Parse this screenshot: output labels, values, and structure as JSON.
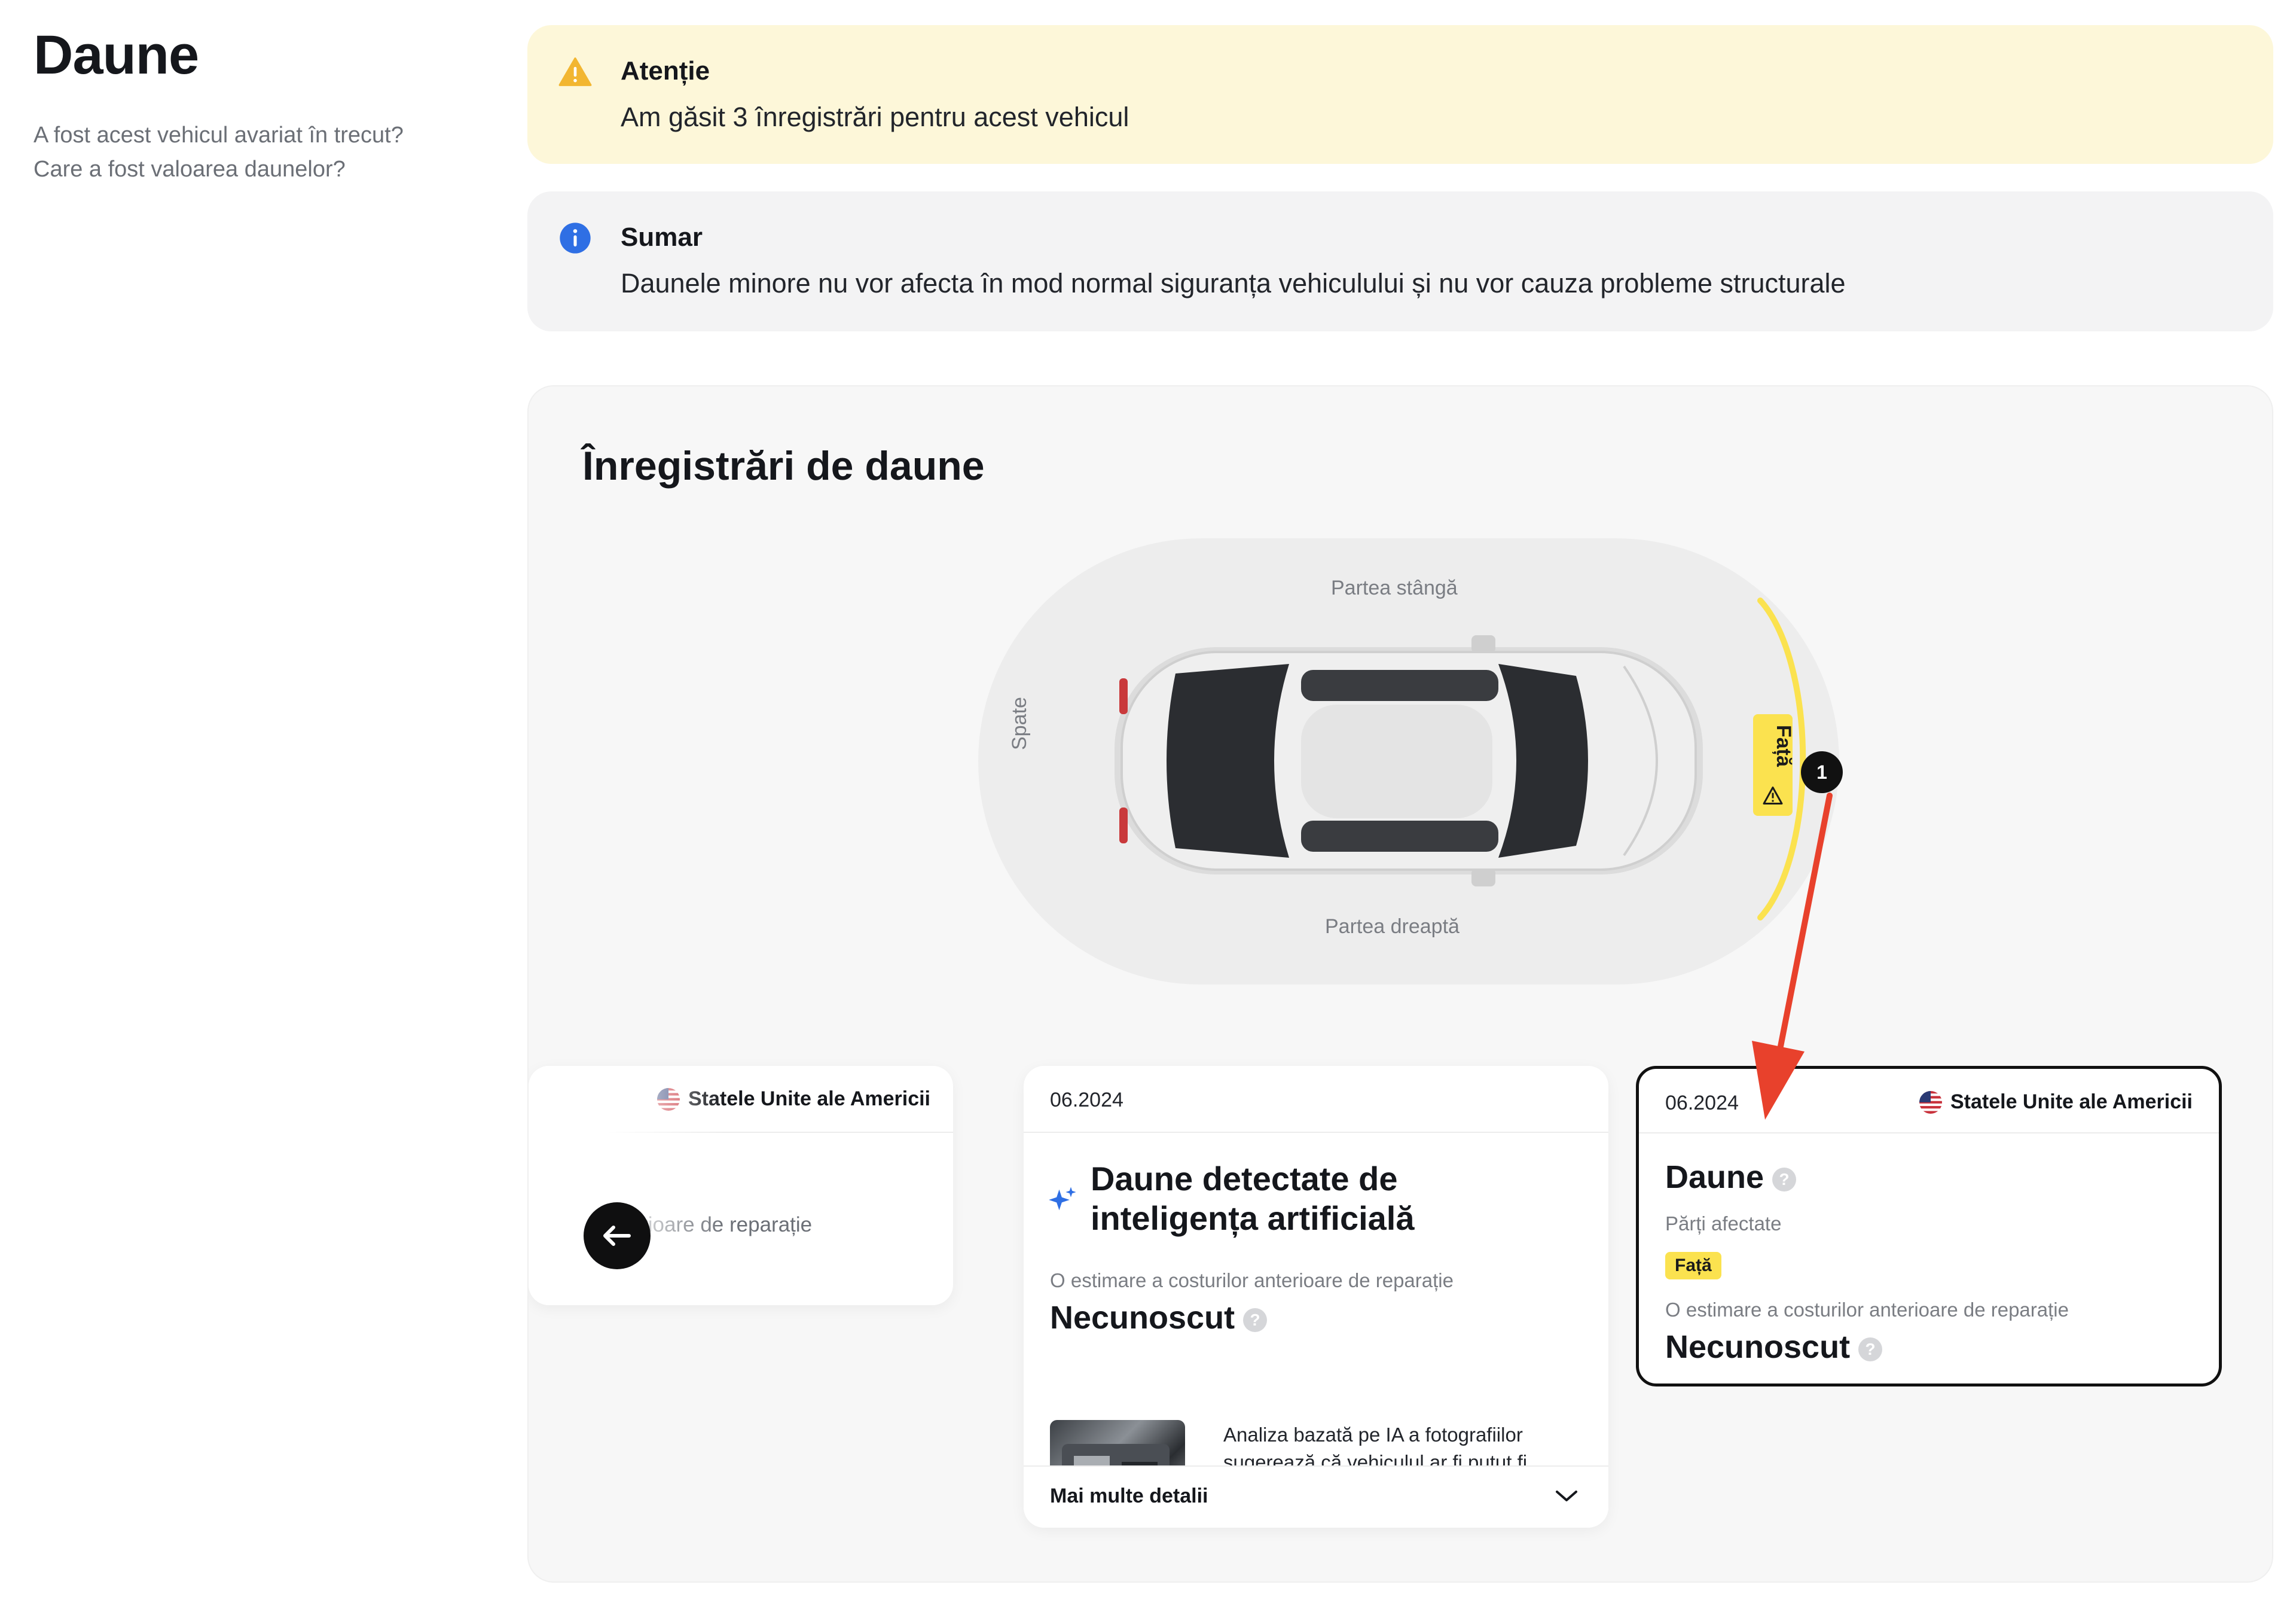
{
  "header": {
    "title": "Daune",
    "subtitle_line1": "A fost acest vehicul avariat în trecut?",
    "subtitle_line2": "Care a fost valoarea daunelor?"
  },
  "alerts": {
    "warning": {
      "title": "Atenție",
      "text": "Am găsit 3 înregistrări pentru acest vehicul",
      "icon": "warning-icon",
      "color": "#f2b631"
    },
    "info": {
      "title": "Sumar",
      "text": "Daunele minore nu vor afecta în mod normal siguranța vehiculului și nu vor cauza probleme structurale",
      "icon": "info-icon",
      "color": "#2f6fe4"
    }
  },
  "records": {
    "title": "Înregistrări de daune",
    "diagram": {
      "label_left": "Partea stângă",
      "label_right": "Partea dreaptă",
      "label_rear": "Spate",
      "front_tag": "Față",
      "marker": "1",
      "highlight_color": "#fbe24f"
    },
    "cards": [
      {
        "country": "Statele Unite ale Americii",
        "partial_text": "anterioare de reparație"
      },
      {
        "date": "06.2024",
        "title": "Daune detectate de inteligența artificială",
        "estimate_label": "O estimare a costurilor anterioare de reparație",
        "estimate_value": "Necunoscut",
        "help": "?",
        "ai_description": "Analiza bazată pe IA a fotografiilor sugerează că vehiculul ar fi putut fi deteriorat",
        "more_details": "Mai multe detalii"
      },
      {
        "date": "06.2024",
        "country": "Statele Unite ale Americii",
        "title": "Daune",
        "help": "?",
        "affected_label": "Părți afectate",
        "affected_badge": "Față",
        "estimate_label": "O estimare a costurilor anterioare de reparație",
        "estimate_value": "Necunoscut"
      }
    ]
  },
  "annotation": {
    "arrow_color": "#e8412c"
  }
}
